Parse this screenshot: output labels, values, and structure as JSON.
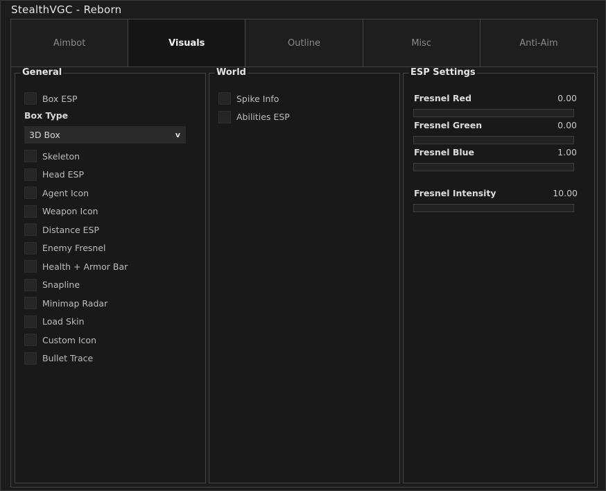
{
  "window": {
    "title": "StealthVGC - Reborn"
  },
  "tabs": [
    {
      "label": "Aimbot",
      "active": false
    },
    {
      "label": "Visuals",
      "active": true
    },
    {
      "label": "Outline",
      "active": false
    },
    {
      "label": "Misc",
      "active": false
    },
    {
      "label": "Anti-Aim",
      "active": false
    }
  ],
  "general": {
    "title": "General",
    "box_esp": "Box ESP",
    "box_type_label": "Box Type",
    "box_type_value": "3D Box",
    "chevron": "v",
    "options": [
      "Skeleton",
      "Head ESP",
      "Agent Icon",
      "Weapon Icon",
      "Distance ESP",
      "Enemy Fresnel",
      "Health + Armor Bar",
      "Snapline",
      "Minimap Radar",
      "Load Skin",
      "Custom Icon",
      "Bullet Trace"
    ]
  },
  "world": {
    "title": "World",
    "options": [
      "Spike Info",
      "Abilities ESP"
    ]
  },
  "esp_settings": {
    "title": "ESP Settings",
    "sliders": [
      {
        "label": "Fresnel Red",
        "value": "0.00",
        "fraction": 0
      },
      {
        "label": "Fresnel Green",
        "value": "0.00",
        "fraction": 0
      },
      {
        "label": "Fresnel Blue",
        "value": "1.00",
        "fraction": 0
      },
      {
        "label": "Fresnel Intensity",
        "value": "10.00",
        "fraction": 0
      }
    ]
  },
  "colors": {
    "background": "#1c1c1c",
    "panel": "#191919",
    "border": "#454545",
    "text": "#bdbdbd"
  }
}
